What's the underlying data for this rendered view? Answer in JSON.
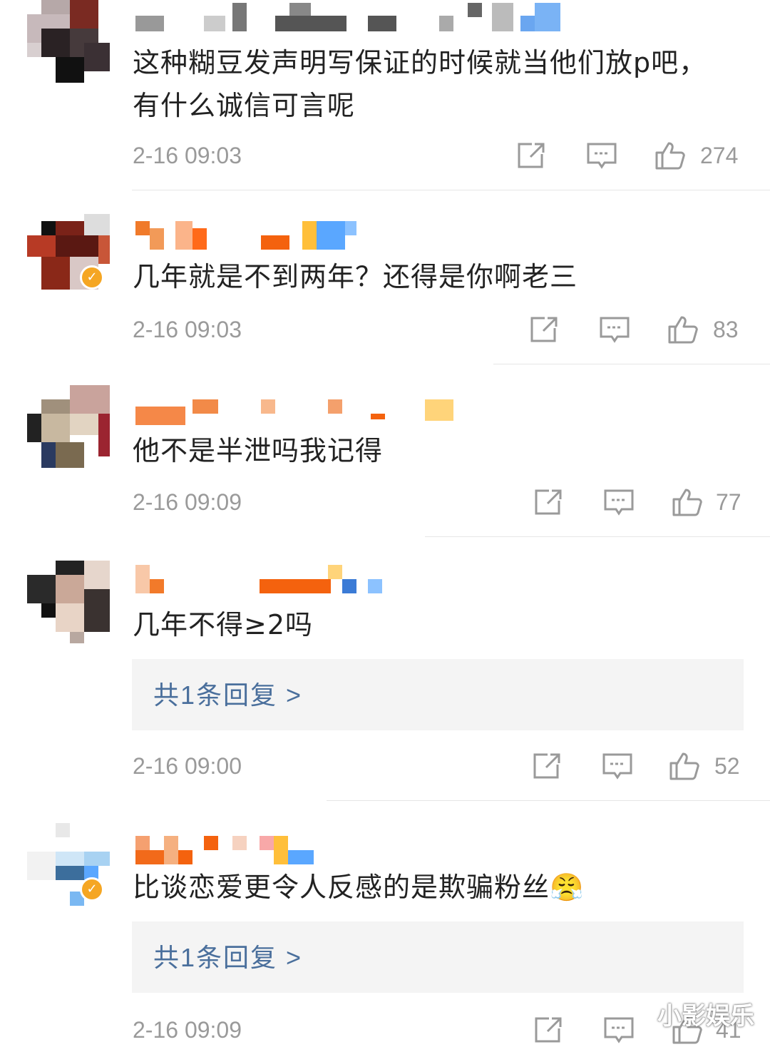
{
  "comments": [
    {
      "text_line1": "这种糊豆发声明写保证的时候就当他们放p吧，",
      "text_line2": "有什么诚信可言呢",
      "time": "2-16 09:03",
      "likes": "274",
      "verified": false
    },
    {
      "text_line1": "几年就是不到两年？还得是你啊老三",
      "time": "2-16 09:03",
      "likes": "83",
      "verified": true
    },
    {
      "text_line1": "他不是半泄吗我记得",
      "time": "2-16 09:09",
      "likes": "77",
      "verified": false
    },
    {
      "text_line1": "几年不得≥2吗",
      "reply_summary": "共1条回复 >",
      "time": "2-16 09:00",
      "likes": "52",
      "verified": false
    },
    {
      "text_line1": "比谈恋爱更令人反感的是欺骗粉丝😤",
      "reply_summary": "共1条回复 >",
      "time": "2-16 09:09",
      "likes": "41",
      "verified": true
    }
  ],
  "watermark": "小影娱乐",
  "colors": {
    "time_gray": "#9a9a9a",
    "reply_link": "#4a6f9c",
    "reply_bg": "#f4f4f4",
    "verified_badge": "#f5a623"
  },
  "icons": [
    "share-icon",
    "comment-icon",
    "like-icon"
  ]
}
